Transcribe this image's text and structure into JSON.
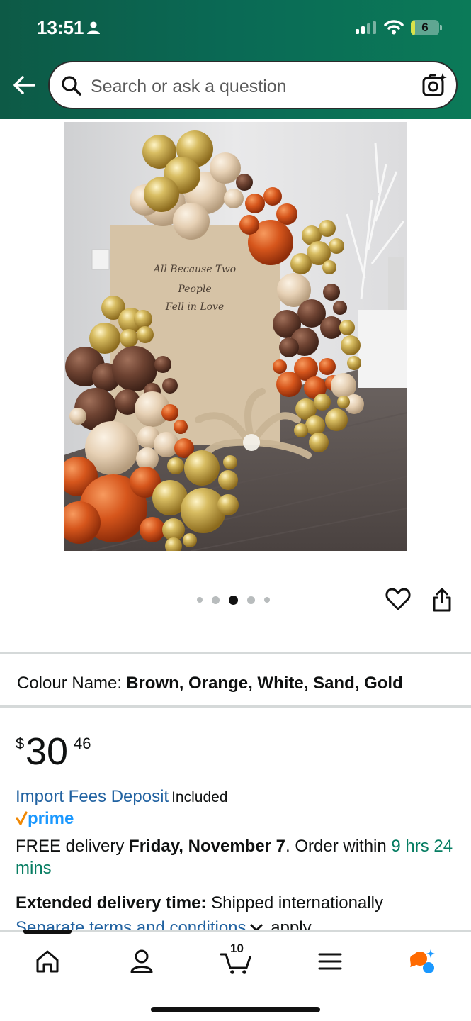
{
  "status_bar": {
    "time": "13:51",
    "battery_level": "6",
    "icons": [
      "person-icon",
      "signal-icon",
      "wifi-icon",
      "battery-icon"
    ]
  },
  "header": {
    "search_placeholder": "Search or ask a question",
    "icons": [
      "back-arrow-icon",
      "search-icon",
      "camera-icon"
    ]
  },
  "product": {
    "image_alt_text": "All Because Two People Fell in Love",
    "carousel": {
      "count": 5,
      "active_index": 2
    },
    "colour_label": "Colour Name:",
    "colour_value": "Brown, Orange, White, Sand, Gold",
    "price": {
      "symbol": "$",
      "whole": "30",
      "fraction": "46"
    },
    "import_fees_link": "Import Fees Deposit",
    "import_fees_status": "Included",
    "prime_label": "prime",
    "delivery": {
      "prefix": "FREE delivery ",
      "date": "Friday, November 7",
      "mid": ". Order within ",
      "countdown": "9 hrs 24 mins"
    },
    "extended_label": "Extended delivery time:",
    "extended_value": " Shipped internationally",
    "terms_link": "Separate terms and conditions",
    "terms_suffix": " apply"
  },
  "bottom_nav": {
    "cart_count": "10",
    "items": [
      "home-icon",
      "account-icon",
      "cart-icon",
      "menu-icon",
      "rufus-icon"
    ]
  },
  "colors": {
    "header_green": "#0a6a55",
    "link_blue": "#2162a1",
    "countdown_green": "#067d62",
    "prime_blue": "#1a98ff",
    "prime_check_orange": "#f08804"
  }
}
